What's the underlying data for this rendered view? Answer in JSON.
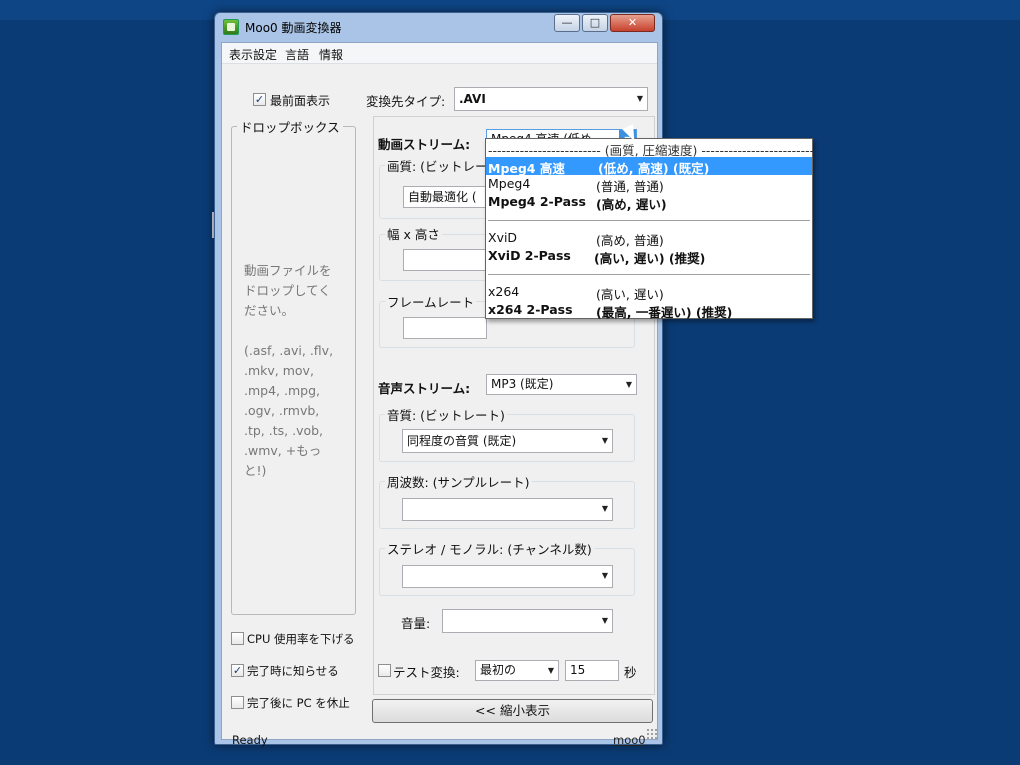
{
  "window": {
    "title": "Moo0 動画変換器",
    "buttons": {
      "minimize": "—",
      "maximize": "□",
      "close": "✕"
    }
  },
  "menu": [
    "表示設定",
    "言語",
    "情報"
  ],
  "left": {
    "topmost_label": "最前面表示",
    "topmost_checked": true,
    "dropbox_title": "ドロップボックス",
    "dropbox_text": "動画ファイルを\nドロップしてく\nださい。\n\n(.asf, .avi, .flv,\n.mkv, mov,\n.mp4, .mpg,\n.ogv, .rmvb,\n.tp, .ts, .vob,\n.wmv, +もっ\nと!)",
    "options": [
      {
        "label": "CPU 使用率を下げる",
        "checked": false
      },
      {
        "label": "完了時に知らせる",
        "checked": true
      },
      {
        "label": "完了後に PC を休止",
        "checked": false
      }
    ]
  },
  "right": {
    "target_type_label": "変換先タイプ:",
    "target_type_value": ".AVI",
    "video_stream_label": "動画ストリーム:",
    "video_stream_value": "Mpeg4  高速    (低め,",
    "video_quality_label": "画質: (ビットレー",
    "video_quality_value": "自動最適化 (",
    "size_label": "幅 x 高さ",
    "framerate_label": "フレームレート",
    "audio_stream_label": "音声ストリーム:",
    "audio_stream_value": "MP3  (既定)",
    "audio_quality_label": "音質: (ビットレート)",
    "audio_quality_value": "同程度の音質 (既定)",
    "frequency_label": "周波数: (サンプルレート)",
    "frequency_value": "",
    "channels_label": "ステレオ / モノラル: (チャンネル数)",
    "channels_value": "",
    "volume_label": "音量:",
    "volume_value": "",
    "test_label": "テスト変換:",
    "test_checked": false,
    "test_mode_value": "最初の",
    "test_seconds_value": "15",
    "seconds_unit": "秒",
    "shrink_button": "<< 縮小表示"
  },
  "dropdown": {
    "header": "------------------------- (画質,  圧縮速度) -------------------------",
    "groups": [
      [
        {
          "name": "Mpeg4  高速",
          "spec": "(低め,  高速) (既定)",
          "bold": true,
          "selected": true
        },
        {
          "name": "Mpeg4",
          "spec": "(普通,  普通)",
          "bold": false,
          "selected": false
        },
        {
          "name": "Mpeg4  2-Pass",
          "spec": "(高め,  遅い)",
          "bold": true,
          "selected": false
        }
      ],
      [
        {
          "name": "XviD",
          "spec": "(高め,  普通)",
          "bold": false,
          "selected": false
        },
        {
          "name": "XviD  2-Pass",
          "spec": "(高い,  遅い) (推奨)",
          "bold": true,
          "selected": false
        }
      ],
      [
        {
          "name": "x264",
          "spec": "(高い,  遅い)",
          "bold": false,
          "selected": false
        },
        {
          "name": "x264  2-Pass",
          "spec": "(最高,  一番遅い) (推奨)",
          "bold": true,
          "selected": false
        }
      ]
    ]
  },
  "status": {
    "text": "Ready",
    "link": "moo0"
  },
  "colors": {
    "desktop": "#0b3b74",
    "selection": "#3399ff"
  }
}
